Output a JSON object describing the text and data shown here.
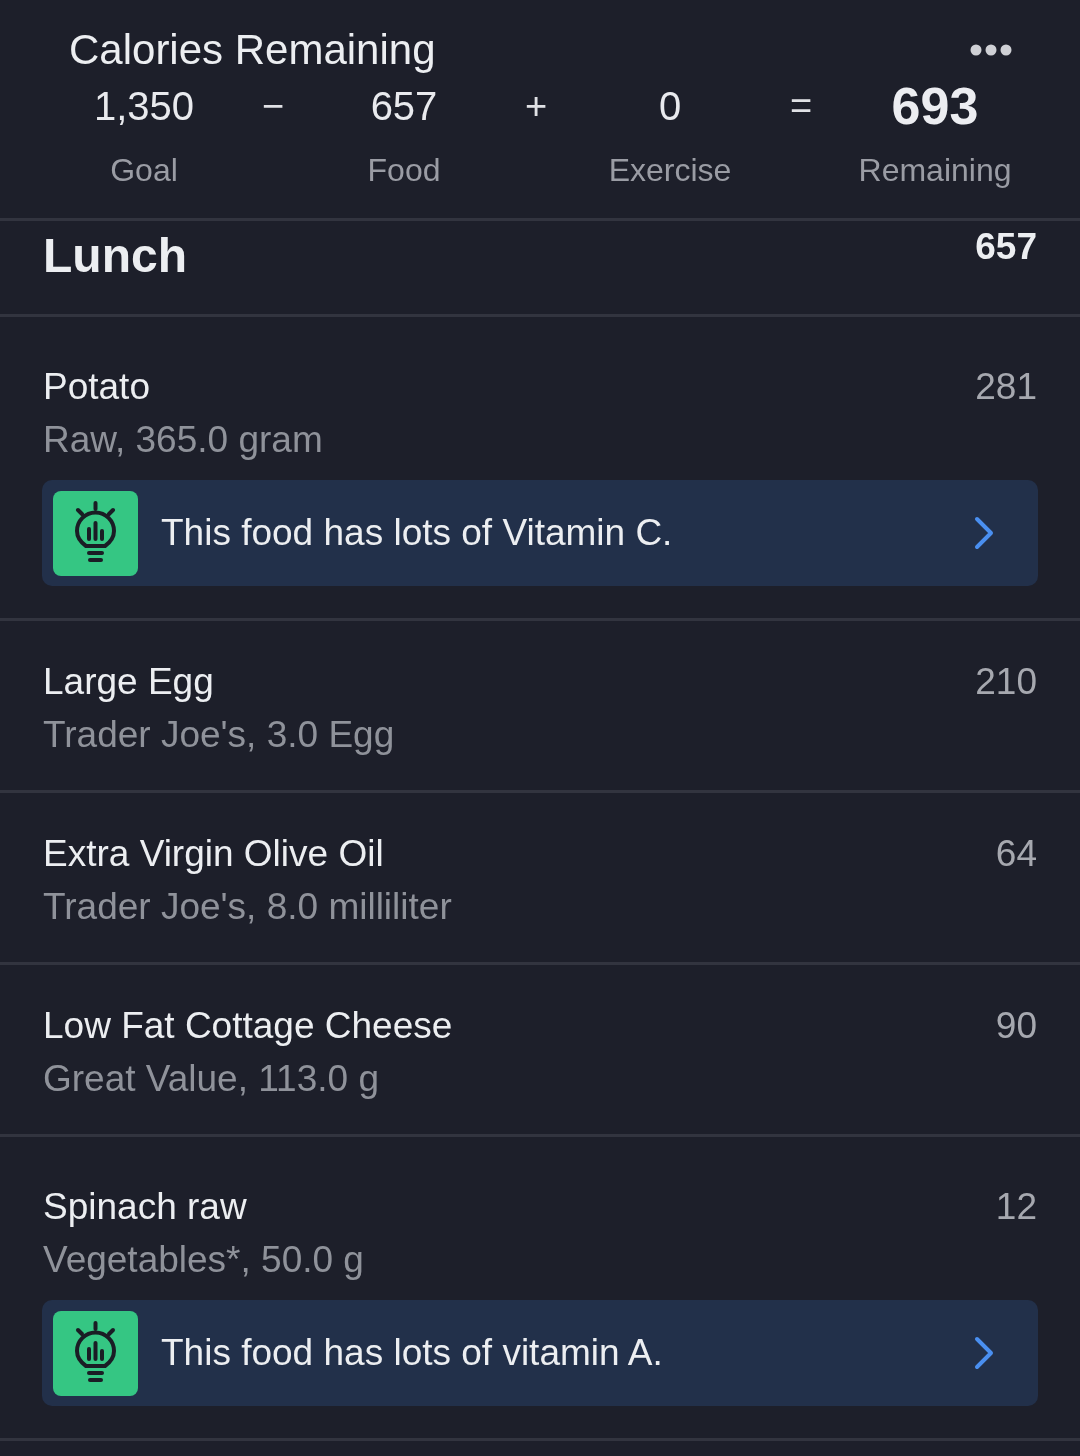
{
  "header": {
    "title": "Calories Remaining"
  },
  "summary": [
    {
      "kind": "term",
      "value": "1,350",
      "label": "Goal"
    },
    {
      "kind": "operator",
      "symbol": "−"
    },
    {
      "kind": "term",
      "value": "657",
      "label": "Food"
    },
    {
      "kind": "operator",
      "symbol": "+"
    },
    {
      "kind": "term",
      "value": "0",
      "label": "Exercise"
    },
    {
      "kind": "operator",
      "symbol": "="
    },
    {
      "kind": "result",
      "value": "693",
      "label": "Remaining"
    }
  ],
  "meal": {
    "name": "Lunch",
    "calories": "657"
  },
  "foods": [
    {
      "name": "Potato",
      "detail": "Raw, 365.0 gram",
      "calories": "281",
      "tip": "This food has lots of Vitamin C."
    },
    {
      "name": "Large Egg",
      "detail": "Trader Joe's, 3.0 Egg",
      "calories": "210"
    },
    {
      "name": "Extra Virgin Olive Oil",
      "detail": "Trader Joe's, 8.0 milliliter",
      "calories": "64"
    },
    {
      "name": "Low Fat Cottage Cheese",
      "detail": "Great Value, 113.0 g",
      "calories": "90"
    },
    {
      "name": "Spinach raw",
      "detail": "Vegetables*, 50.0 g",
      "calories": "12",
      "tip": "This food has lots of vitamin A."
    }
  ]
}
